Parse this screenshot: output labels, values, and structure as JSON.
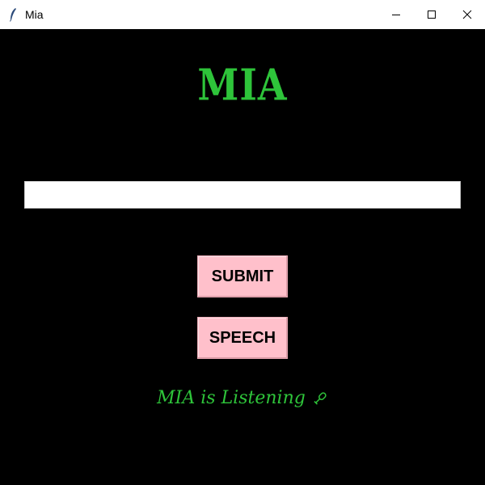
{
  "window": {
    "title": "Mia",
    "icons": {
      "app": "feather-icon",
      "minimize": "minimize-icon",
      "maximize": "maximize-icon",
      "close": "close-icon"
    }
  },
  "main": {
    "heading": "MIA",
    "input": {
      "value": "",
      "placeholder": ""
    },
    "buttons": {
      "submit_label": "SUBMIT",
      "speech_label": "SPEECH"
    },
    "status": {
      "text": "MIA is Listening",
      "icon": "microphone-icon"
    }
  },
  "colors": {
    "background": "#000000",
    "accent_green": "#2ec43a",
    "button_pink": "#ffc0cb",
    "titlebar": "#ffffff"
  }
}
